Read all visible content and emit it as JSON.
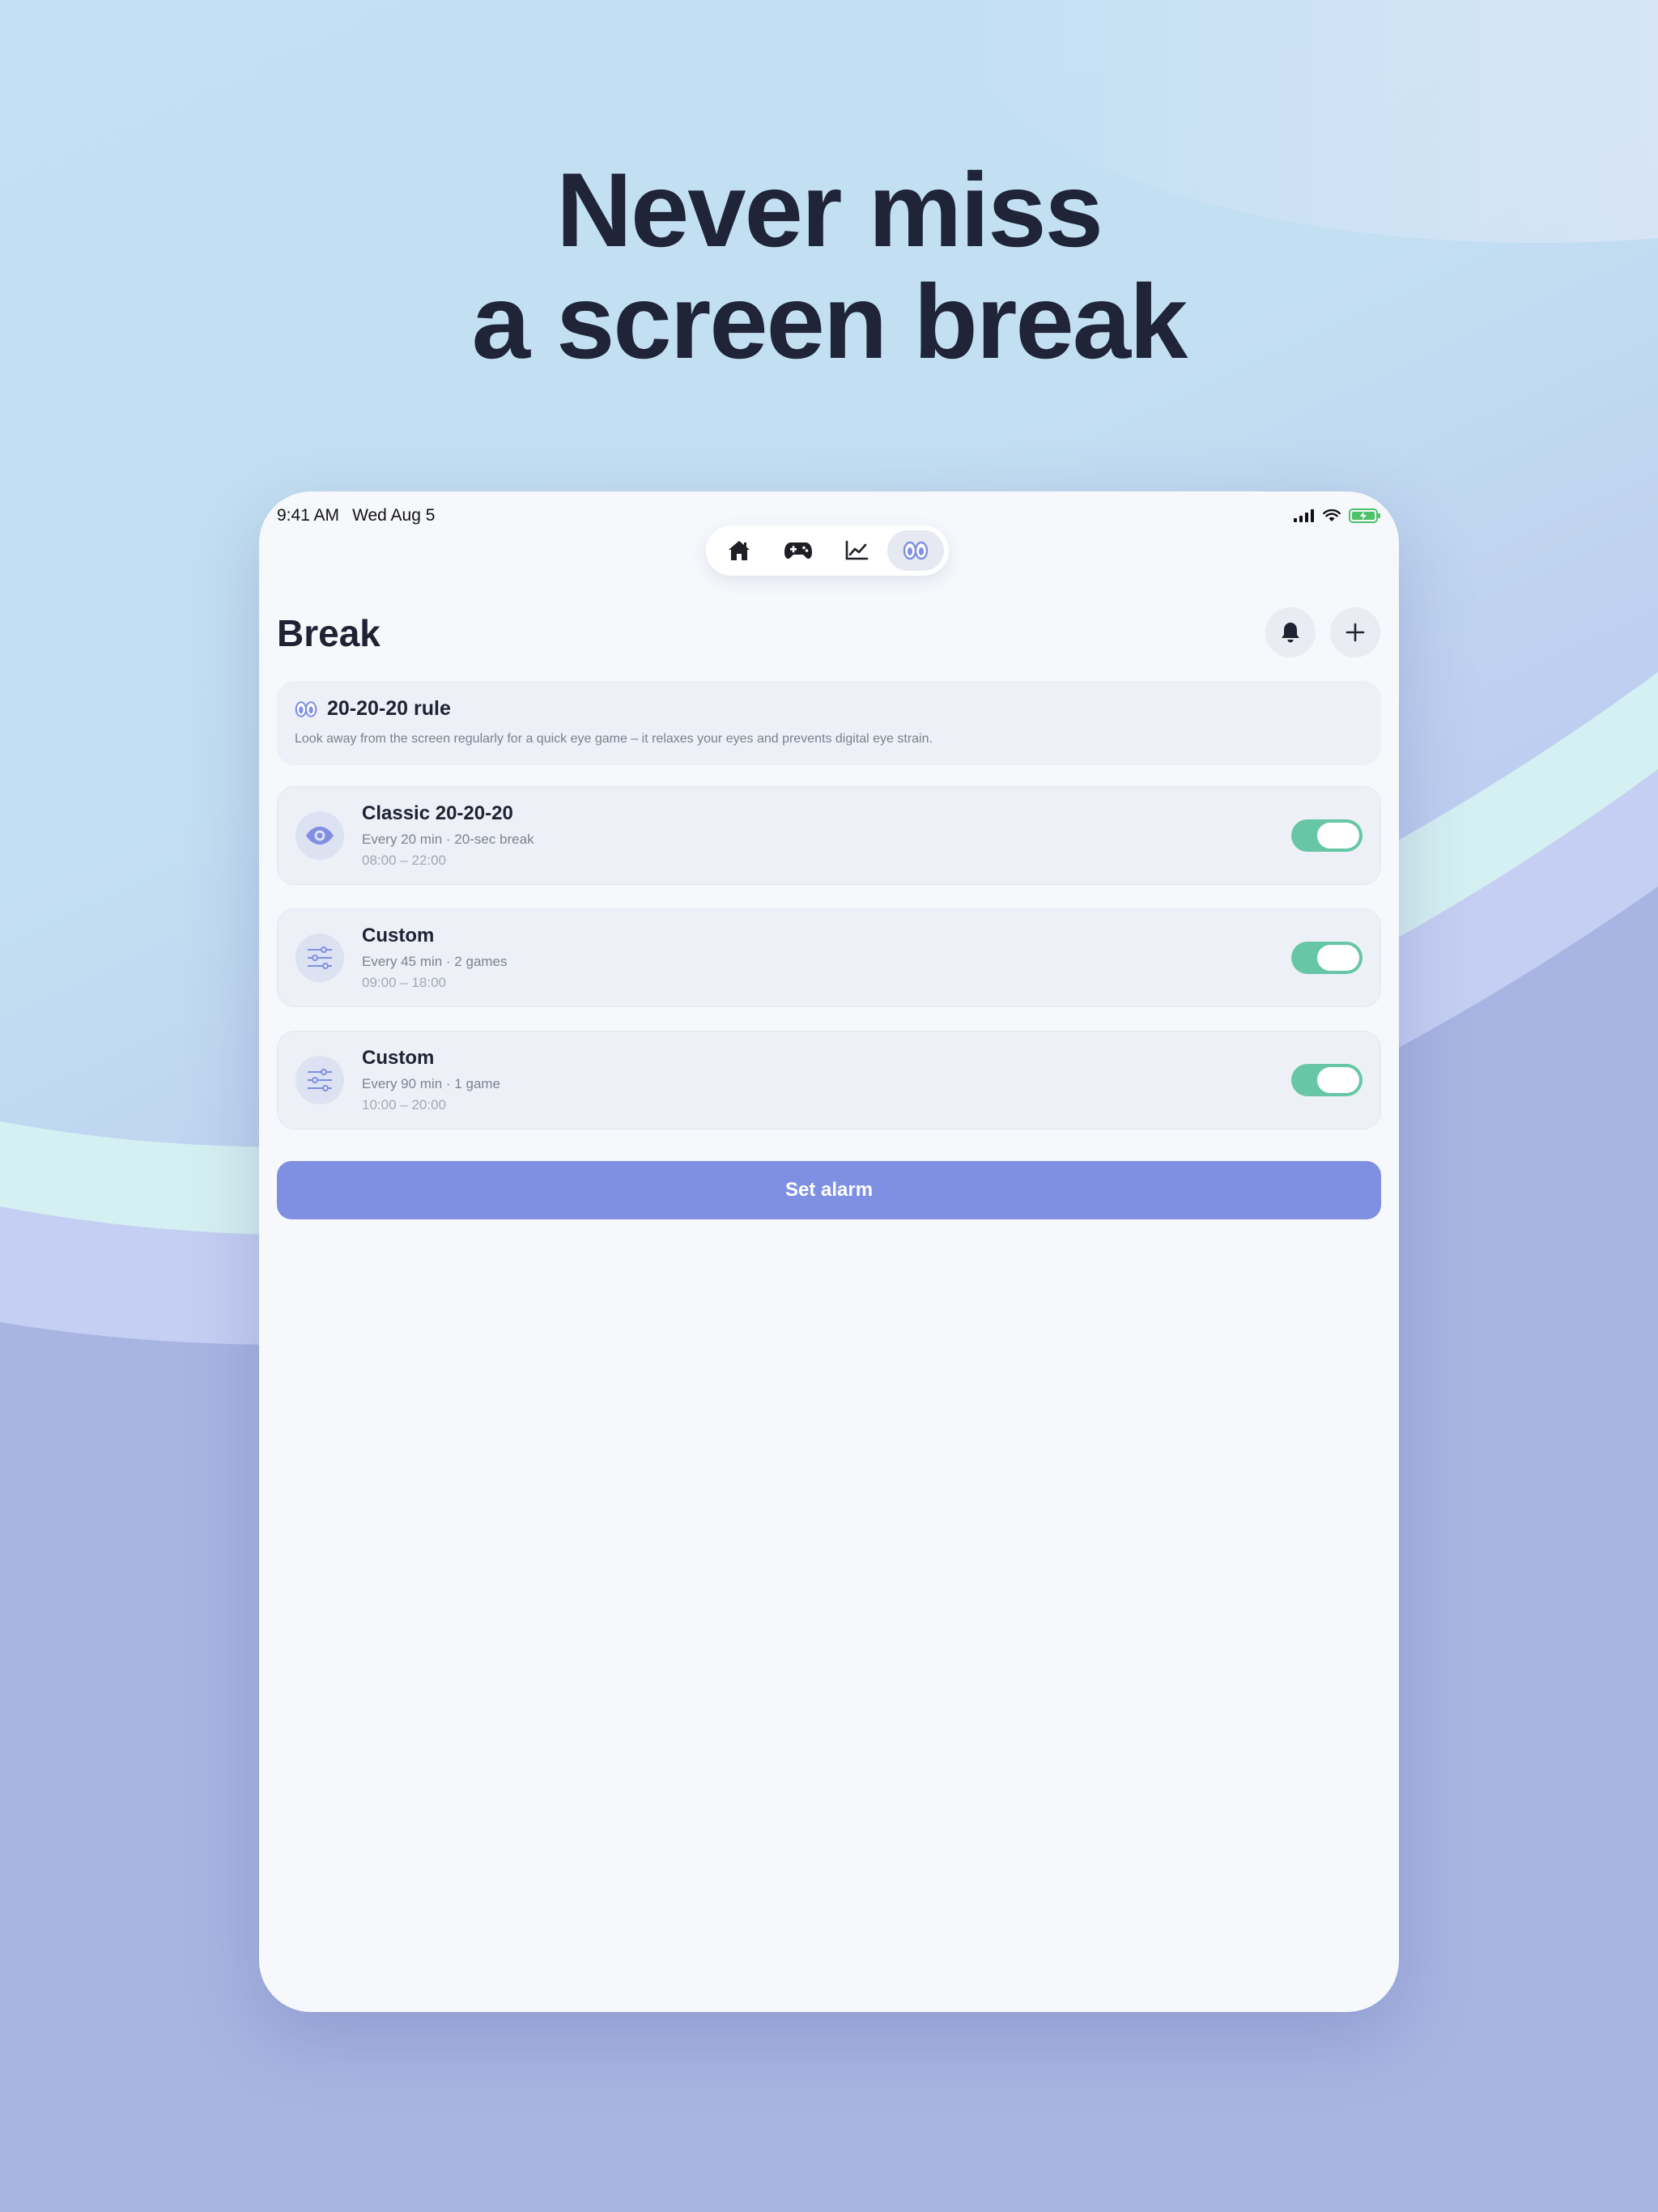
{
  "headline": {
    "line1": "Never miss",
    "line2": "a screen break"
  },
  "status_bar": {
    "time": "9:41 AM",
    "date": "Wed Aug 5",
    "icons": [
      "cellular-signal-icon",
      "wifi-icon",
      "battery-charging-icon"
    ]
  },
  "tab_bar": {
    "tabs": [
      {
        "icon": "home-icon",
        "active": false
      },
      {
        "icon": "gamepad-icon",
        "active": false
      },
      {
        "icon": "chart-icon",
        "active": false
      },
      {
        "icon": "eyes-icon",
        "active": true
      }
    ]
  },
  "page": {
    "title": "Break"
  },
  "header_actions": {
    "icons": [
      "bell-icon",
      "plus-icon"
    ]
  },
  "info_card": {
    "title": "20-20-20 rule",
    "description": "Look away from the screen regularly for a quick eye game – it relaxes your eyes and prevents digital eye strain.",
    "icon": "eyes-icon"
  },
  "alarms": [
    {
      "name": "Classic 20-20-20",
      "detail": "Every 20 min · 20-sec break",
      "hours": "08:00 – 22:00",
      "icon": "eye-icon",
      "enabled": true
    },
    {
      "name": "Custom",
      "detail": "Every 45 min · 2 games",
      "hours": "09:00 – 18:00",
      "icon": "sliders-icon",
      "enabled": true
    },
    {
      "name": "Custom",
      "detail": "Every 90 min · 1 game",
      "hours": "10:00 – 20:00",
      "icon": "sliders-icon",
      "enabled": true
    }
  ],
  "cta": {
    "label": "Set alarm"
  },
  "colors": {
    "accent": "#7f8fe1",
    "toggle_on": "#67c6a5",
    "text_dark": "#1e2233",
    "card_bg": "#edf0f6"
  }
}
